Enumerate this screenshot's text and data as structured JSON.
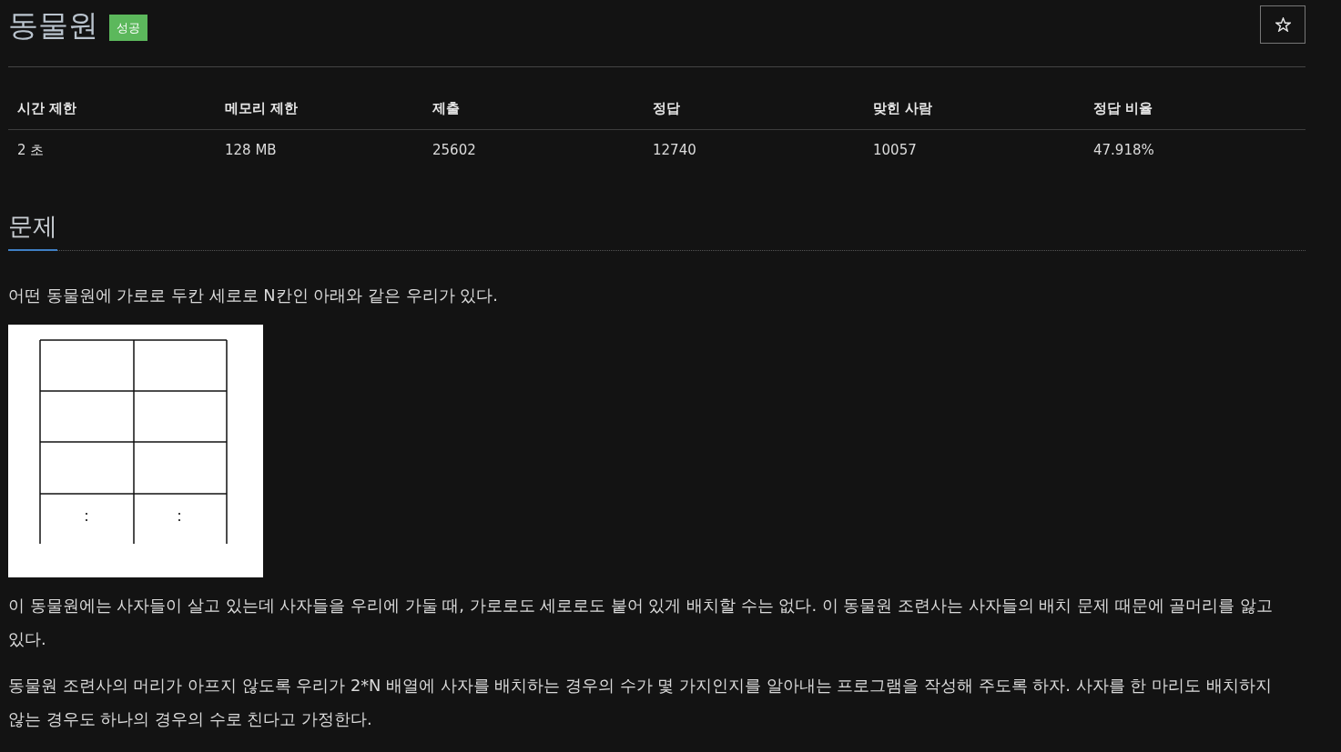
{
  "problem_header": {
    "title": "동물원",
    "result_badge": "성공"
  },
  "info_table": {
    "columns": [
      "시간 제한",
      "메모리 제한",
      "제출",
      "정답",
      "맞힌 사람",
      "정답 비율"
    ],
    "rows": [
      [
        "2 초",
        "128 MB",
        "25602",
        "12740",
        "10057",
        "47.918%"
      ]
    ]
  },
  "section": {
    "heading": "문제",
    "content": [
      {
        "kind": "text",
        "text": "어떤 동물원에 가로로 두칸 세로로 N칸인 아래와 같은 우리가 있다."
      },
      {
        "kind": "figure"
      },
      {
        "kind": "text",
        "text": "이 동물원에는 사자들이 살고 있는데 사자들을 우리에 가둘 때, 가로로도 세로로도 붙어 있게 배치할 수는 없다. 이 동물원 조련사는 사자들의 배치 문제 때문에 골머리를 앓고 있다."
      },
      {
        "kind": "text",
        "text": "동물원 조련사의 머리가 아프지 않도록 우리가 2*N 배열에 사자를 배치하는 경우의 수가 몇 가지인지를 알아내는 프로그램을 작성해 주도록 하자. 사자를 한 마리도 배치하지 않는 경우도 하나의 경우의 수로 친다고 가정한다."
      }
    ]
  }
}
